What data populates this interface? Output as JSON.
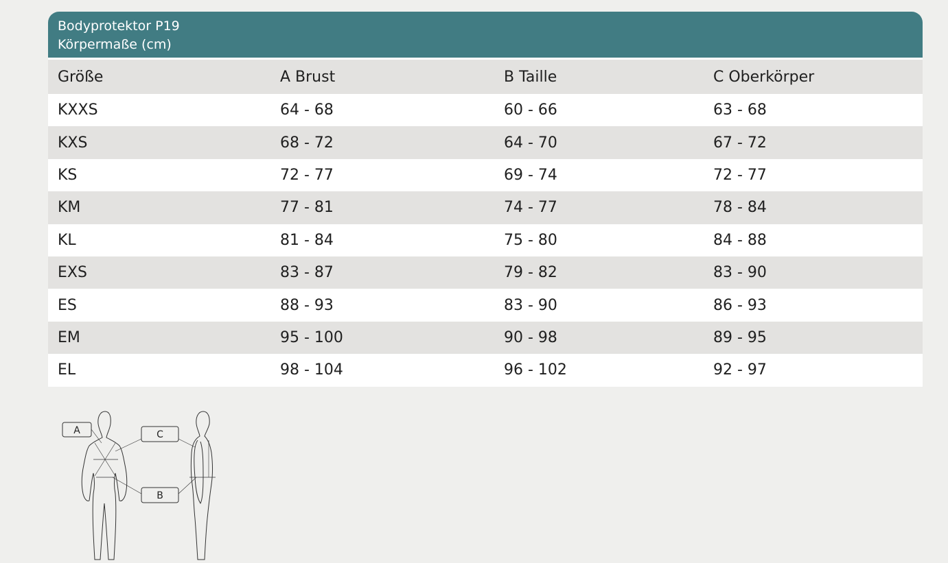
{
  "header": {
    "title": "Bodyprotektor P19",
    "subtitle": "Körpermaße (cm)"
  },
  "columns": [
    "Größe",
    "A  Brust",
    "B  Taille",
    "C  Oberkörper"
  ],
  "rows": [
    [
      "KXXS",
      "64 - 68",
      "60 - 66",
      "63 - 68"
    ],
    [
      "KXS",
      "68 - 72",
      "64 - 70",
      "67 - 72"
    ],
    [
      "KS",
      "72 - 77",
      "69 - 74",
      "72 - 77"
    ],
    [
      "KM",
      "77 - 81",
      "74 - 77",
      "78 - 84"
    ],
    [
      "KL",
      "81 - 84",
      "75 - 80",
      "84 - 88"
    ],
    [
      "EXS",
      "83 - 87",
      "79 - 82",
      "83 - 90"
    ],
    [
      "ES",
      "88 - 93",
      "83 - 90",
      "86 - 93"
    ],
    [
      "EM",
      "95 - 100",
      "90 - 98",
      "89 - 95"
    ],
    [
      "EL",
      "98 - 104",
      "96 - 102",
      "92 - 97"
    ]
  ],
  "figure": {
    "labels": [
      "A",
      "C",
      "B"
    ]
  }
}
